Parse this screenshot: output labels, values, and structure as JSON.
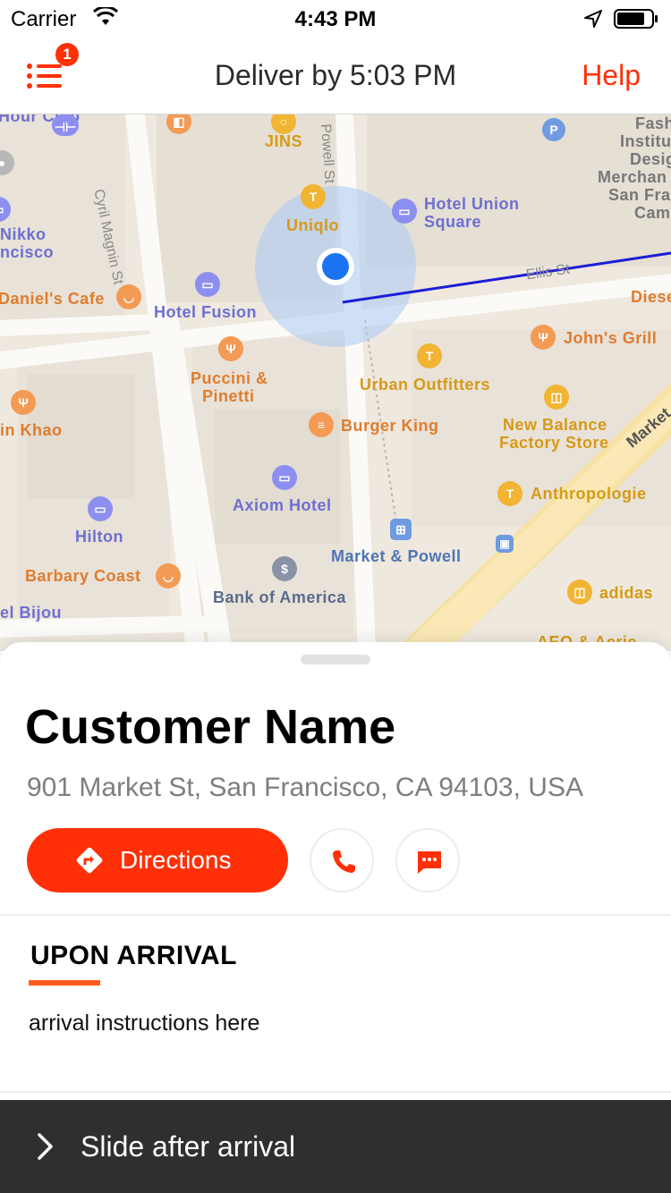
{
  "status_bar": {
    "carrier": "Carrier",
    "time": "4:43 PM"
  },
  "nav": {
    "title": "Deliver by 5:03 PM",
    "help_label": "Help",
    "menu_badge_count": "1"
  },
  "map": {
    "pois": {
      "hour_club": "Hour\n Club",
      "jins": "JINS",
      "nikko": "Nikko",
      "ncisco": "ncisco",
      "uniqlo": "Uniqlo",
      "hotel_union_square_1": "Hotel Union",
      "hotel_union_square_2": "Square",
      "fash": "Fash",
      "institu": "Institu",
      "desig": "Desig",
      "merchan": "Merchan",
      "san_fra": "San Fra",
      "cam": "Cam",
      "daniels_cafe": "Daniel's Cafe",
      "hotel_fusion": "Hotel Fusion",
      "diese": "Diese",
      "johns_grill": "John's Grill",
      "puccini_1": "Puccini &",
      "puccini_2": "Pinetti",
      "urban_outfitters": "Urban Outfitters",
      "in_khao": "in Khao",
      "burger_king": "Burger King",
      "new_balance_1": "New Balance",
      "new_balance_2": "Factory Store",
      "axiom_hotel": "Axiom Hotel",
      "anthropologie": "Anthropologie",
      "hilton": "Hilton",
      "market_powell": "Market & Powell",
      "barbary_coast": "Barbary Coast",
      "bank_of_america": "Bank of America",
      "adidas": "adidas",
      "el_bijou": "el Bijou",
      "aeo_aerie": "AEO & Aerie"
    },
    "streets": {
      "cyril_magnin": "Cyril Magnin St",
      "powell": "Powell St",
      "ellis": "Ellis St",
      "market": "Market"
    }
  },
  "sheet": {
    "customer_name": "Customer Name",
    "address": "901 Market St, San Francisco, CA 94103, USA",
    "directions_label": "Directions",
    "upon_arrival_title": "UPON ARRIVAL",
    "arrival_instructions": "arrival instructions here"
  },
  "slide_bar": {
    "label": "Slide after arrival"
  },
  "colors": {
    "accent": "#ff3008",
    "underline": "#ff5a1a",
    "slide_bar": "#2f2f2f",
    "user_location": "#1a73f2",
    "route_line": "#1d1dd6"
  }
}
